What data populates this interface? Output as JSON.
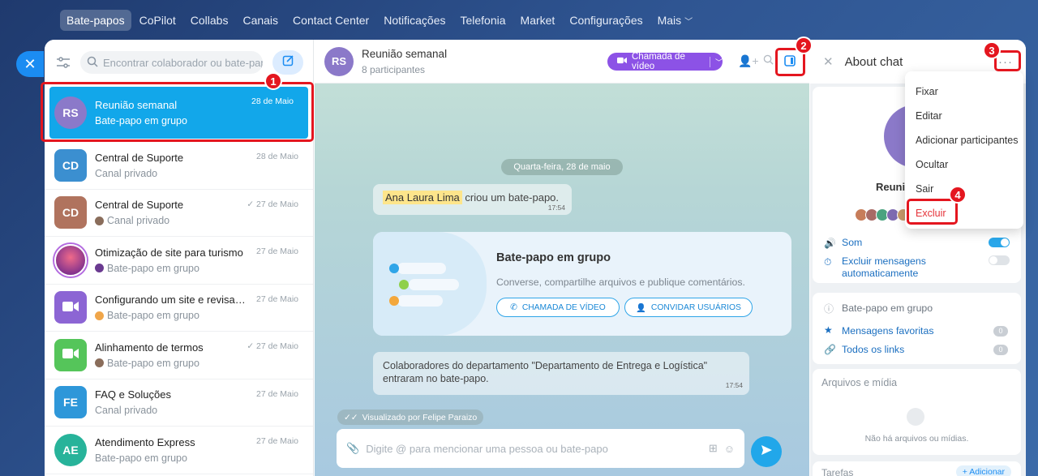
{
  "topnav": [
    "Bate-papos",
    "CoPilot",
    "Collabs",
    "Canais",
    "Contact Center",
    "Notificações",
    "Telefonia",
    "Market",
    "Configurações",
    "Mais"
  ],
  "left": {
    "search_placeholder": "Encontrar colaborador ou bate-papo",
    "chats": [
      {
        "initials": "RS",
        "title": "Reunião semanal",
        "sub": "Bate-papo em grupo",
        "date": "28 de Maio",
        "color": "#8b79c9"
      },
      {
        "initials": "CD",
        "title": "Central de Suporte",
        "sub": "Canal privado",
        "date": "28 de Maio",
        "color": "#3b8fd0"
      },
      {
        "initials": "CD",
        "title": "Central de Suporte",
        "sub": "Canal privado",
        "date": "27 de Maio",
        "color": "#b0735e"
      },
      {
        "initials": "",
        "title": "Otimização de site para turismo",
        "sub": "Bate-papo em grupo",
        "date": "27 de Maio",
        "color": "#7a2fb8"
      },
      {
        "initials": "",
        "title": "Configurando um site e revisand...",
        "sub": "Bate-papo em grupo",
        "date": "27 de Maio",
        "color": "#8c65d4"
      },
      {
        "initials": "",
        "title": "Alinhamento de termos",
        "sub": "Bate-papo em grupo",
        "date": "27 de Maio",
        "color": "#55c55a"
      },
      {
        "initials": "FE",
        "title": "FAQ e Soluções",
        "sub": "Canal privado",
        "date": "27 de Maio",
        "color": "#2e97d9"
      },
      {
        "initials": "AE",
        "title": "Atendimento Express",
        "sub": "Bate-papo em grupo",
        "date": "27 de Maio",
        "color": "#27b39a"
      }
    ]
  },
  "center": {
    "initials": "RS",
    "title": "Reunião semanal",
    "participants": "8 participantes",
    "call_label": "Chamada de vídeo",
    "date_pill": "Quarta-feira, 28 de maio",
    "msg1_name": "Ana Laura Lima",
    "msg1_text": "criou um bate-papo.",
    "msg1_time": "17:54",
    "card_title": "Bate-papo em grupo",
    "card_desc": "Converse, compartilhe arquivos e publique comentários.",
    "card_btn1": "CHAMADA DE VÍDEO",
    "card_btn2": "CONVIDAR USUÁRIOS",
    "msg2_text": "Colaboradores do departamento \"Departamento de Entrega e Logística\" entraram no bate-papo.",
    "msg2_time": "17:54",
    "seen": "Visualizado por Felipe Paraizo",
    "composer_placeholder": "Digite @ para mencionar uma pessoa ou bate-papo"
  },
  "right": {
    "title": "About chat",
    "chat_name_partial": "Reuniã",
    "sound": "Som",
    "autodelete": "Excluir mensagens automaticamente",
    "type": "Bate-papo em grupo",
    "fav": "Mensagens favoritas",
    "fav_count": "0",
    "links": "Todos os links",
    "links_count": "0",
    "files_title": "Arquivos e mídia",
    "files_empty": "Não há arquivos ou mídias.",
    "tasks": "Tarefas",
    "add": "+ Adicionar"
  },
  "menu": [
    "Fixar",
    "Editar",
    "Adicionar participantes",
    "Ocultar",
    "Sair",
    "Excluir"
  ],
  "markers": [
    "1",
    "2",
    "3",
    "4"
  ]
}
